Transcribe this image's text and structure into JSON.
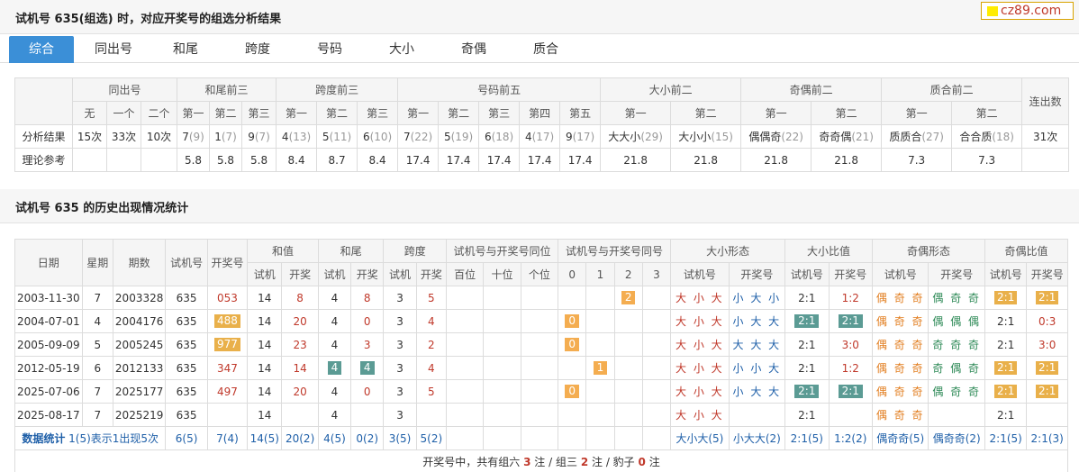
{
  "header": {
    "title": "试机号 635(组选) 时，对应开奖号的组选分析结果",
    "logo": "cz89.com"
  },
  "tabs": [
    "综合",
    "同出号",
    "和尾",
    "跨度",
    "号码",
    "大小",
    "奇偶",
    "质合"
  ],
  "analysis": {
    "groups": [
      "同出号",
      "和尾前三",
      "跨度前三",
      "号码前五",
      "大小前二",
      "奇偶前二",
      "质合前二",
      "连出数"
    ],
    "sub": [
      "无",
      "一个",
      "二个",
      "第一",
      "第二",
      "第三",
      "第一",
      "第二",
      "第三",
      "第一",
      "第二",
      "第三",
      "第四",
      "第五",
      "第一",
      "第二",
      "第一",
      "第二",
      "第一",
      "第二"
    ],
    "row1_label": "分析结果",
    "row1": [
      {
        "v": "15次",
        "c": ""
      },
      {
        "v": "33次",
        "c": ""
      },
      {
        "v": "10次",
        "c": ""
      },
      {
        "v": "7",
        "c": "(9)"
      },
      {
        "v": "1",
        "c": "(7)"
      },
      {
        "v": "9",
        "c": "(7)"
      },
      {
        "v": "4",
        "c": "(13)"
      },
      {
        "v": "5",
        "c": "(11)"
      },
      {
        "v": "6",
        "c": "(10)"
      },
      {
        "v": "7",
        "c": "(22)"
      },
      {
        "v": "5",
        "c": "(19)"
      },
      {
        "v": "6",
        "c": "(18)"
      },
      {
        "v": "4",
        "c": "(17)"
      },
      {
        "v": "9",
        "c": "(17)"
      },
      {
        "v": "大大小",
        "c": "(29)"
      },
      {
        "v": "大小小",
        "c": "(15)"
      },
      {
        "v": "偶偶奇",
        "c": "(22)"
      },
      {
        "v": "奇奇偶",
        "c": "(21)"
      },
      {
        "v": "质质合",
        "c": "(27)"
      },
      {
        "v": "合合质",
        "c": "(18)"
      },
      {
        "v": "31次",
        "c": ""
      }
    ],
    "row2_label": "理论参考",
    "row2": [
      "",
      "",
      "",
      "5.8",
      "5.8",
      "5.8",
      "8.4",
      "8.7",
      "8.4",
      "17.4",
      "17.4",
      "17.4",
      "17.4",
      "17.4",
      "21.8",
      "21.8",
      "21.8",
      "21.8",
      "7.3",
      "7.3",
      ""
    ]
  },
  "history": {
    "title": "试机号 635 的历史出现情况统计",
    "head_main": [
      "日期",
      "星期",
      "期数",
      "试机号",
      "开奖号",
      "和值",
      "和尾",
      "跨度",
      "试机号与开奖号同位",
      "试机号与开奖号同号",
      "大小形态",
      "大小比值",
      "奇偶形态",
      "奇偶比值"
    ],
    "head_sub": [
      "试机",
      "开奖",
      "试机",
      "开奖",
      "试机",
      "开奖",
      "百位",
      "十位",
      "个位",
      "0",
      "1",
      "2",
      "3",
      "试机号",
      "开奖号",
      "试机号",
      "开奖号",
      "试机号",
      "开奖号",
      "试机号",
      "开奖号"
    ],
    "rows": [
      {
        "date": "2003-11-30",
        "wk": "7",
        "qi": "2003328",
        "sj": "635",
        "kj": "053",
        "kjHi": false,
        "hz": [
          "14",
          "8"
        ],
        "hw": [
          "4",
          "8"
        ],
        "hwHi": false,
        "kd": [
          "3",
          "5"
        ],
        "sh": [
          1,
          0
        ],
        "tw": [
          "",
          "",
          ""
        ],
        "th": [
          "",
          "",
          "2",
          ""
        ],
        "dx": [
          "大 小 大",
          "小 大 小"
        ],
        "dxb": [
          "2:1",
          "1:2"
        ],
        "dxbHi": [
          false,
          false
        ],
        "jo": [
          "偶 奇 奇",
          "偶 奇 奇"
        ],
        "job": [
          "2:1",
          "2:1"
        ],
        "jobHi": [
          true,
          true
        ]
      },
      {
        "date": "2004-07-01",
        "wk": "4",
        "qi": "2004176",
        "sj": "635",
        "kj": "488",
        "kjHi": true,
        "hz": [
          "14",
          "20"
        ],
        "hw": [
          "4",
          "0"
        ],
        "hwHi": false,
        "kd": [
          "3",
          "4"
        ],
        "sh": [
          0,
          0
        ],
        "tw": [
          "",
          "",
          ""
        ],
        "th": [
          "0",
          "",
          "",
          ""
        ],
        "dx": [
          "大 小 大",
          "小 大 大"
        ],
        "dxb": [
          "2:1",
          "2:1"
        ],
        "dxbHi": [
          true,
          true
        ],
        "jo": [
          "偶 奇 奇",
          "偶 偶 偶"
        ],
        "job": [
          "2:1",
          "0:3"
        ],
        "jobHi": [
          false,
          false
        ]
      },
      {
        "date": "2005-09-09",
        "wk": "5",
        "qi": "2005245",
        "sj": "635",
        "kj": "977",
        "kjHi": true,
        "hz": [
          "14",
          "23"
        ],
        "hw": [
          "4",
          "3"
        ],
        "hwHi": false,
        "kd": [
          "3",
          "2"
        ],
        "sh": [
          0,
          0
        ],
        "tw": [
          "",
          "",
          ""
        ],
        "th": [
          "0",
          "",
          "",
          ""
        ],
        "dx": [
          "大 小 大",
          "大 大 大"
        ],
        "dxb": [
          "2:1",
          "3:0"
        ],
        "dxbHi": [
          false,
          false
        ],
        "jo": [
          "偶 奇 奇",
          "奇 奇 奇"
        ],
        "job": [
          "2:1",
          "3:0"
        ],
        "jobHi": [
          false,
          false
        ]
      },
      {
        "date": "2012-05-19",
        "wk": "6",
        "qi": "2012133",
        "sj": "635",
        "kj": "347",
        "kjHi": false,
        "hz": [
          "14",
          "14"
        ],
        "hw": [
          "4",
          "4"
        ],
        "hwHi": true,
        "kd": [
          "3",
          "4"
        ],
        "sh": [
          0,
          0
        ],
        "tw": [
          "",
          "",
          ""
        ],
        "th": [
          "",
          "1",
          "",
          ""
        ],
        "dx": [
          "大 小 大",
          "小 小 大"
        ],
        "dxb": [
          "2:1",
          "1:2"
        ],
        "dxbHi": [
          false,
          false
        ],
        "jo": [
          "偶 奇 奇",
          "奇 偶 奇"
        ],
        "job": [
          "2:1",
          "2:1"
        ],
        "jobHi": [
          true,
          true
        ]
      },
      {
        "date": "2025-07-06",
        "wk": "7",
        "qi": "2025177",
        "sj": "635",
        "kj": "497",
        "kjHi": false,
        "hz": [
          "14",
          "20"
        ],
        "hw": [
          "4",
          "0"
        ],
        "hwHi": false,
        "kd": [
          "3",
          "5"
        ],
        "sh": [
          0,
          0
        ],
        "tw": [
          "",
          "",
          ""
        ],
        "th": [
          "0",
          "",
          "",
          ""
        ],
        "dx": [
          "大 小 大",
          "小 大 大"
        ],
        "dxb": [
          "2:1",
          "2:1"
        ],
        "dxbHi": [
          true,
          true
        ],
        "jo": [
          "偶 奇 奇",
          "偶 奇 奇"
        ],
        "job": [
          "2:1",
          "2:1"
        ],
        "jobHi": [
          true,
          true
        ]
      },
      {
        "date": "2025-08-17",
        "wk": "7",
        "qi": "2025219",
        "sj": "635",
        "kj": "",
        "kjHi": false,
        "hz": [
          "14",
          ""
        ],
        "hw": [
          "4",
          ""
        ],
        "hwHi": false,
        "kd": [
          "3",
          ""
        ],
        "sh": [
          0,
          0
        ],
        "tw": [
          "",
          "",
          ""
        ],
        "th": [
          "",
          "",
          "",
          ""
        ],
        "dx": [
          "大 小 大",
          ""
        ],
        "dxb": [
          "2:1",
          ""
        ],
        "dxbHi": [
          false,
          false
        ],
        "jo": [
          "偶 奇 奇",
          ""
        ],
        "job": [
          "2:1",
          ""
        ],
        "jobHi": [
          false,
          false
        ]
      }
    ],
    "stats_label": "数据统计",
    "stats_note": "1(5)表示1出现5次",
    "stats": [
      "6(5)",
      "7(4)",
      "14(5)",
      "20(2)",
      "4(5)",
      "0(2)",
      "3(5)",
      "5(2)",
      "",
      "",
      "",
      "",
      "",
      "",
      "",
      "大小大(5)",
      "小大大(2)",
      "2:1(5)",
      "1:2(2)",
      "偶奇奇(5)",
      "偶奇奇(2)",
      "2:1(5)",
      "2:1(3)"
    ],
    "footer_prefix": "开奖号中，共有组六",
    "footer_g6": "3",
    "footer_mid1": "注 / 组三",
    "footer_g3": "2",
    "footer_mid2": "注 / 豹子",
    "footer_bz": "0",
    "footer_suffix": "注"
  }
}
